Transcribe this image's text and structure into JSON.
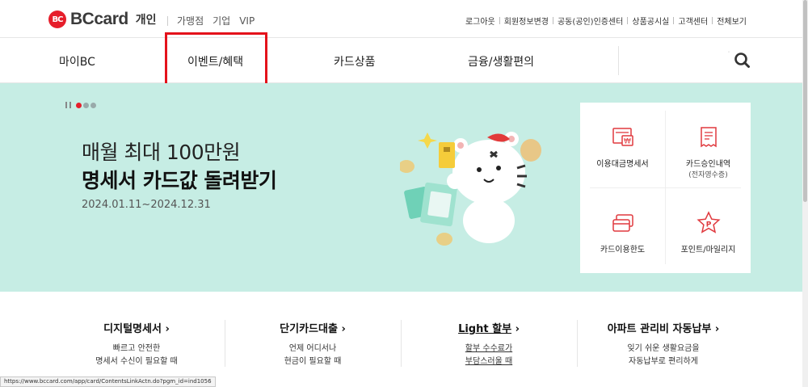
{
  "brand": {
    "mark": "BC",
    "name": "BCcard",
    "section": "개인"
  },
  "segments": [
    "가맹점",
    "기업",
    "VIP"
  ],
  "utility_links": [
    "로그아웃",
    "회원정보변경",
    "공동(공인)인증센터",
    "상품공시실",
    "고객센터",
    "전체보기"
  ],
  "nav": {
    "items": [
      "마이BC",
      "이벤트/혜택",
      "카드상품",
      "금융/생활편의"
    ],
    "highlighted": "이벤트/혜택"
  },
  "hero": {
    "headline": "매월 최대 100만원",
    "headline_bold": "명세서 카드값 돌려받기",
    "period": "2024.01.11~2024.12.31",
    "slides": {
      "total": 3,
      "active": 1
    }
  },
  "quick_menu": [
    {
      "label": "이용대금명세서",
      "sub": "",
      "icon": "statement-icon"
    },
    {
      "label": "카드승인내역",
      "sub": "(전자영수증)",
      "icon": "receipt-icon"
    },
    {
      "label": "카드이용한도",
      "sub": "",
      "icon": "card-limit-icon"
    },
    {
      "label": "포인트/마일리지",
      "sub": "",
      "icon": "point-star-icon"
    }
  ],
  "services": [
    {
      "title": "디지털명세서",
      "arrow": "›",
      "desc1": "빠르고 안전한",
      "desc2": "명세서 수신이 필요할 때"
    },
    {
      "title": "단기카드대출",
      "arrow": "›",
      "desc1": "언제 어디서나",
      "desc2": "현금이 필요할 때"
    },
    {
      "title": "Light 할부",
      "arrow": "›",
      "desc1": "할부 수수료가",
      "desc2": "부담스러울 때"
    },
    {
      "title": "아파트 관리비 자동납부",
      "arrow": "›",
      "desc1": "잊기 쉬운 생활요금을",
      "desc2": "자동납부로 편리하게"
    }
  ],
  "status_url": "https://www.bccard.com/app/card/ContentsLinkActn.do?pgm_id=ind1056",
  "colors": {
    "brand_red": "#e61e2b",
    "hero_bg": "#c6ede4",
    "highlight_box": "#e4121b"
  }
}
